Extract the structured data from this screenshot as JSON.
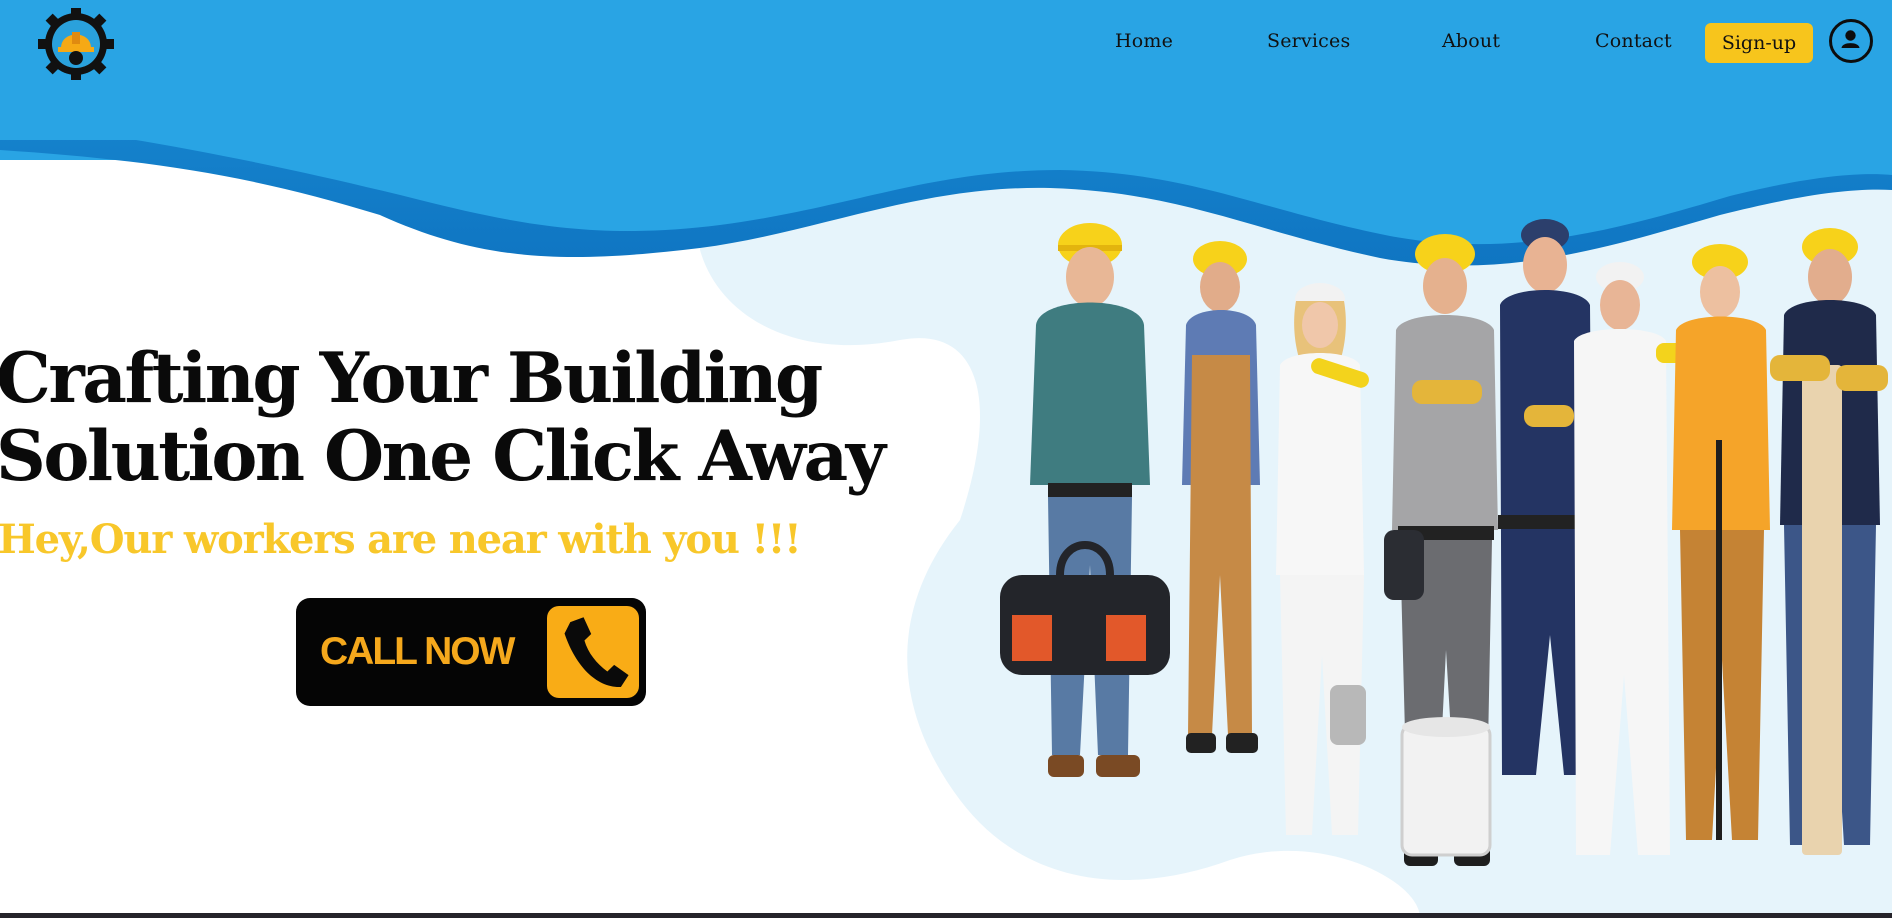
{
  "nav": {
    "home": "Home",
    "services": "Services",
    "about": "About",
    "contact": "Contact",
    "signup": "Sign-up"
  },
  "hero": {
    "headline_line1": "Crafting Your Building",
    "headline_line2": "Solution One Click Away",
    "tagline": "Hey,Our workers are near with you !!!",
    "cta_label": "CALL NOW"
  },
  "colors": {
    "band": "#29a4e4",
    "band_dark": "#1283ce",
    "accent_yellow": "#f8c72a",
    "light_blob": "#e5f4fb"
  },
  "icons": [
    "gear-logo-icon",
    "user-circle-icon",
    "phone-icon"
  ]
}
